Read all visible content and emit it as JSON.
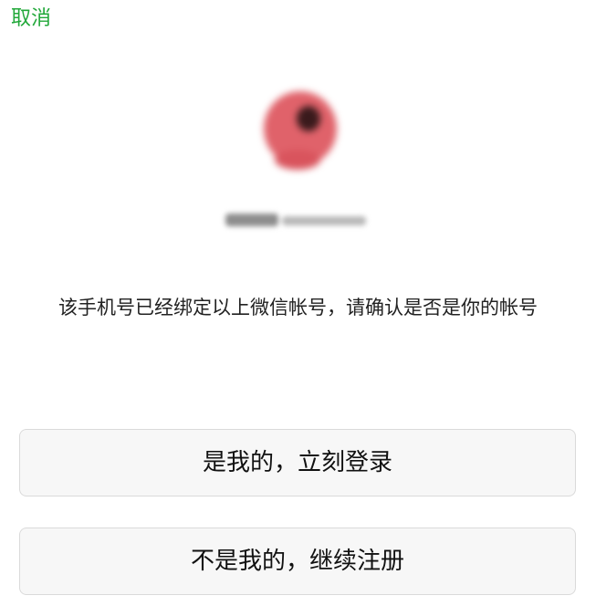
{
  "header": {
    "cancel_label": "取消"
  },
  "account": {
    "message": "该手机号已经绑定以上微信帐号，请确认是否是你的帐号"
  },
  "actions": {
    "confirm_login_label": "是我的，立刻登录",
    "register_label": "不是我的，继续注册"
  },
  "colors": {
    "accent": "#22a83a",
    "button_bg": "#f7f7f7",
    "button_border": "#dadada"
  }
}
